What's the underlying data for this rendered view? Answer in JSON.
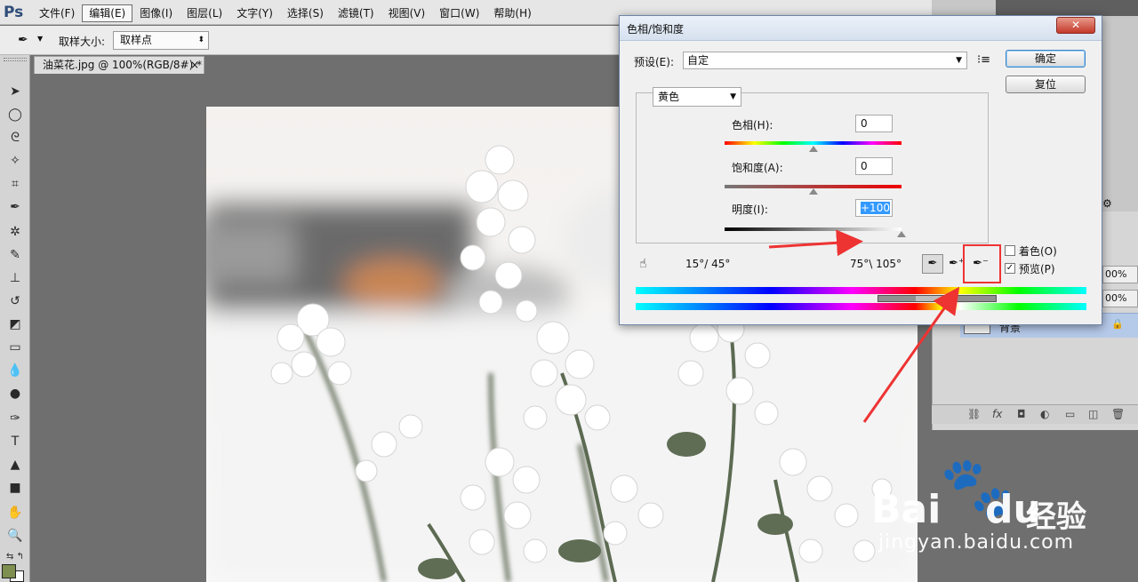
{
  "app": {
    "logo": "Ps"
  },
  "menu": [
    "文件(F)",
    "编辑(E)",
    "图像(I)",
    "图层(L)",
    "文字(Y)",
    "选择(S)",
    "滤镜(T)",
    "视图(V)",
    "窗口(W)",
    "帮助(H)"
  ],
  "menu_active": "编辑(E)",
  "options": {
    "sample_label": "取样大小:",
    "sample_value": "取样点"
  },
  "document_tab": {
    "title": "油菜花.jpg @ 100%(RGB/8#) *",
    "close": "×"
  },
  "dialog": {
    "title": "色相/饱和度",
    "close": "✕",
    "preset_label": "预设(E):",
    "preset_value": "自定",
    "ok": "确定",
    "reset": "复位",
    "channel": "黄色",
    "hue_label": "色相(H):",
    "hue_value": "0",
    "saturation_label": "饱和度(A):",
    "saturation_value": "0",
    "lightness_label": "明度(I):",
    "lightness_value": "+100",
    "range_left": "15°/ 45°",
    "range_right": "75°\\ 105°",
    "colorize_label": "着色(O)",
    "preview_label": "预览(P)",
    "colorize_checked": false,
    "preview_checked": true,
    "hue_slider": 0,
    "saturation_slider": 0,
    "lightness_slider": 100
  },
  "layers": {
    "background_name": "背景",
    "opacity": "00%",
    "fill": "00%"
  },
  "watermark": {
    "brand": "Bai",
    "brand2": "du",
    "cn": "经验",
    "url": "jingyan.baidu.com"
  },
  "colors": {
    "accent_red": "#ee3333",
    "foreground_swatch": "#7e8f4f"
  }
}
